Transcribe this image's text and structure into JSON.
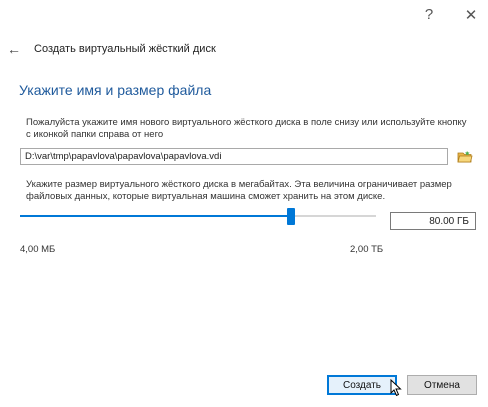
{
  "window": {
    "help_glyph": "?",
    "close_glyph": "✕"
  },
  "header": {
    "back_glyph": "←",
    "title": "Создать виртуальный жёсткий диск"
  },
  "main": {
    "heading": "Укажите имя и размер файла",
    "instruction_location": "Пожалуйста укажите имя нового виртуального жёсткого диска в поле снизу или используйте кнопку с иконкой папки справа от него",
    "file_path": "D:\\var\\tmp\\papavlova\\papavlova\\papavlova.vdi",
    "instruction_size": "Укажите размер виртуального жёсткого диска в мегабайтах. Эта величина ограничивает размер файловых данных, которые виртуальная машина сможет хранить на этом диске.",
    "size_value": "80.00 ГБ",
    "slider_position_fraction": 0.76,
    "slider_min_label": "4,00 МБ",
    "slider_max_label": "2,00 ТБ"
  },
  "buttons": {
    "create_label": "Создать",
    "cancel_label": "Отмена"
  },
  "colors": {
    "accent": "#0078d7",
    "heading": "#1f5a9c"
  },
  "icons": {
    "folder": "folder-open-icon",
    "back": "back-arrow-icon",
    "help": "help-icon",
    "close": "close-icon"
  }
}
